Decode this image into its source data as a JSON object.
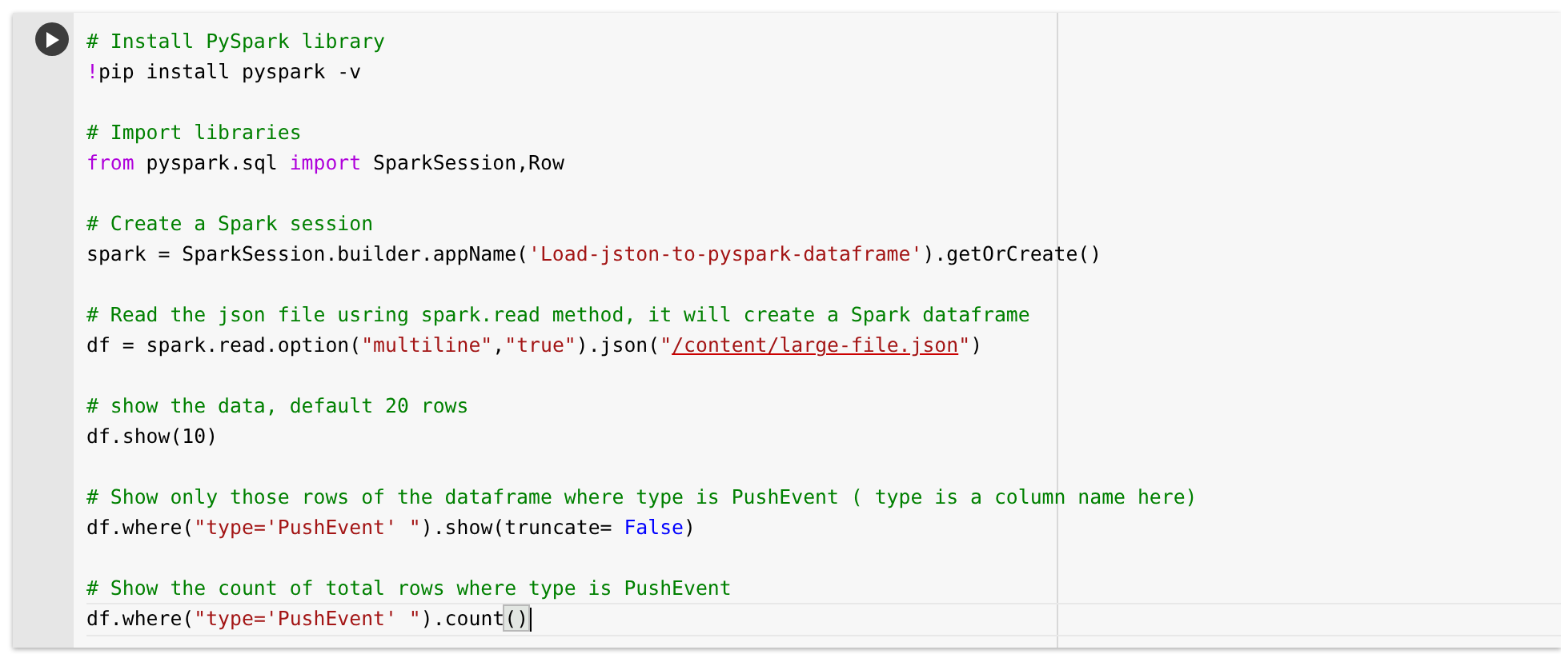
{
  "cell": {
    "run_button": true,
    "lines": [
      {
        "kind": "code",
        "tokens": [
          {
            "kind": "comment",
            "text": "# Install PySpark library"
          }
        ]
      },
      {
        "kind": "code",
        "tokens": [
          {
            "kind": "keyword",
            "text": "!"
          },
          {
            "kind": "plain",
            "text": "pip install pyspark -v"
          }
        ]
      },
      {
        "kind": "blank"
      },
      {
        "kind": "code",
        "tokens": [
          {
            "kind": "comment",
            "text": "# Import libraries"
          }
        ]
      },
      {
        "kind": "code",
        "tokens": [
          {
            "kind": "keyword",
            "text": "from"
          },
          {
            "kind": "plain",
            "text": " pyspark.sql "
          },
          {
            "kind": "keyword",
            "text": "import"
          },
          {
            "kind": "plain",
            "text": " SparkSession,Row"
          }
        ]
      },
      {
        "kind": "blank"
      },
      {
        "kind": "code",
        "tokens": [
          {
            "kind": "comment",
            "text": "# Create a Spark session"
          }
        ]
      },
      {
        "kind": "code",
        "tokens": [
          {
            "kind": "plain",
            "text": "spark = SparkSession.builder.appName("
          },
          {
            "kind": "string",
            "text": "'Load-jston-to-pyspark-dataframe'"
          },
          {
            "kind": "plain",
            "text": ").getOrCreate()"
          }
        ]
      },
      {
        "kind": "blank"
      },
      {
        "kind": "code",
        "tokens": [
          {
            "kind": "comment",
            "text": "# Read the json file usring spark.read method, it will create a Spark dataframe"
          }
        ]
      },
      {
        "kind": "code",
        "tokens": [
          {
            "kind": "plain",
            "text": "df = spark.read.option("
          },
          {
            "kind": "string",
            "text": "\"multiline\""
          },
          {
            "kind": "plain",
            "text": ","
          },
          {
            "kind": "string",
            "text": "\"true\""
          },
          {
            "kind": "plain",
            "text": ").json("
          },
          {
            "kind": "string",
            "text": "\""
          },
          {
            "kind": "path",
            "text": "/content/large-file.json"
          },
          {
            "kind": "string",
            "text": "\""
          },
          {
            "kind": "plain",
            "text": ")"
          }
        ]
      },
      {
        "kind": "blank"
      },
      {
        "kind": "code",
        "tokens": [
          {
            "kind": "comment",
            "text": "# show the data, default 20 rows"
          }
        ]
      },
      {
        "kind": "code",
        "tokens": [
          {
            "kind": "plain",
            "text": "df.show(10)"
          }
        ]
      },
      {
        "kind": "blank"
      },
      {
        "kind": "code",
        "tokens": [
          {
            "kind": "comment",
            "text": "# Show only those rows of the dataframe where type is PushEvent ( type is a column name here)"
          }
        ]
      },
      {
        "kind": "code",
        "tokens": [
          {
            "kind": "plain",
            "text": "df.where("
          },
          {
            "kind": "string",
            "text": "\"type='PushEvent' \""
          },
          {
            "kind": "plain",
            "text": ").show(truncate= "
          },
          {
            "kind": "boolean",
            "text": "False"
          },
          {
            "kind": "plain",
            "text": ")"
          }
        ]
      },
      {
        "kind": "blank"
      },
      {
        "kind": "code",
        "tokens": [
          {
            "kind": "comment",
            "text": "# Show the count of total rows where type is PushEvent"
          }
        ]
      },
      {
        "kind": "code",
        "current": true,
        "tokens": [
          {
            "kind": "plain",
            "text": "df.where("
          },
          {
            "kind": "string",
            "text": "\"type='PushEvent' \""
          },
          {
            "kind": "plain",
            "text": ").count"
          },
          {
            "kind": "bracket",
            "text": "()"
          }
        ]
      }
    ]
  }
}
